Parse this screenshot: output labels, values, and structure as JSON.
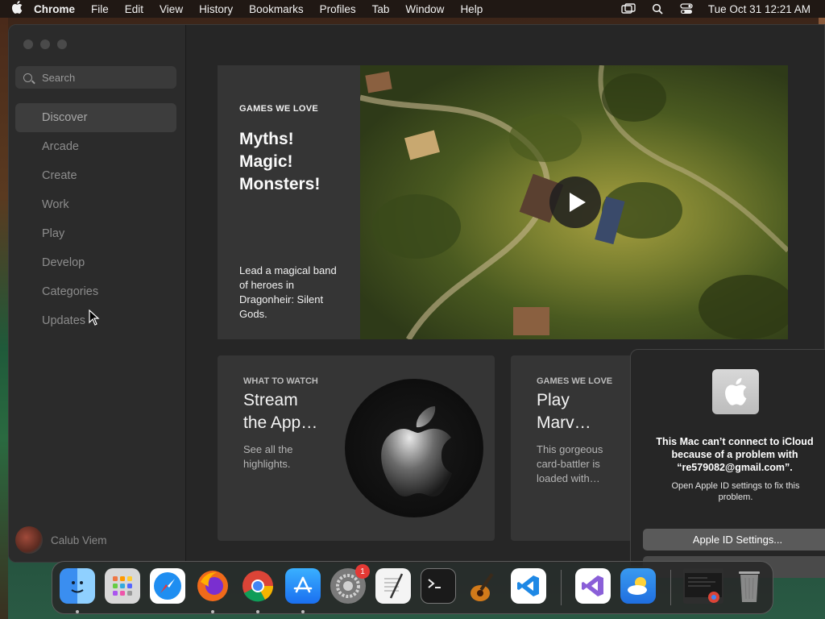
{
  "menubar": {
    "apple_icon": "apple-logo-icon",
    "items": [
      "Chrome",
      "File",
      "Edit",
      "View",
      "History",
      "Bookmarks",
      "Profiles",
      "Tab",
      "Window",
      "Help"
    ],
    "status_icons": [
      "screen-mirroring-icon",
      "spotlight-search-icon",
      "control-center-icon"
    ],
    "datetime": "Tue Oct 31  12:21 AM"
  },
  "sidebar": {
    "search_placeholder": "Search",
    "items": [
      {
        "label": "Discover",
        "active": true
      },
      {
        "label": "Arcade"
      },
      {
        "label": "Create"
      },
      {
        "label": "Work"
      },
      {
        "label": "Play"
      },
      {
        "label": "Develop"
      },
      {
        "label": "Categories"
      },
      {
        "label": "Updates"
      }
    ],
    "user": {
      "name": "Calub Viem"
    }
  },
  "hero": {
    "eyebrow": "GAMES WE LOVE",
    "title": "Myths!\nMagic!\nMonsters!",
    "description": "Lead a magical band of heroes in Dragonheir: Silent Gods."
  },
  "cards": [
    {
      "eyebrow": "WHAT TO WATCH",
      "title": "Stream\nthe App…",
      "description": "See all the highlights."
    },
    {
      "eyebrow": "GAMES WE LOVE",
      "title": "Play\nMarv…",
      "description": "This gorgeous card-battler is loaded with…"
    }
  ],
  "notification": {
    "icon": "apple-logo-icon",
    "headline": "This Mac can’t connect to iCloud because of a problem with “re579082@gmail.com”.",
    "subtext": "Open Apple ID settings to fix this problem.",
    "button": "Apple ID Settings..."
  },
  "dock": {
    "apps": [
      "finder",
      "launchpad",
      "safari",
      "firefox",
      "chrome",
      "app-store",
      "system-settings",
      "textedit",
      "terminal",
      "garageband",
      "vscode",
      "visual-studio",
      "weather",
      "chrome-window-preview",
      "trash"
    ],
    "system_settings_badge": "1"
  }
}
